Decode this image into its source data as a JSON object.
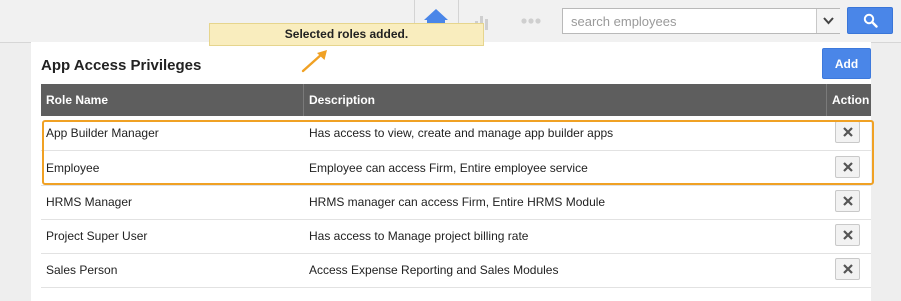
{
  "topbar": {
    "icons": [
      "home-icon",
      "bar-chart-icon",
      "more-dots-icon",
      "chevron-down-icon",
      "search-icon"
    ],
    "search_placeholder": "search employees"
  },
  "toast": {
    "message": "Selected roles added."
  },
  "section": {
    "title": "App Access Privileges",
    "add_label": "Add"
  },
  "table": {
    "headers": [
      "Role Name",
      "Description",
      "Action"
    ],
    "rows": [
      {
        "role": "App Builder Manager",
        "description": "Has access to view, create and manage app builder apps"
      },
      {
        "role": "Employee",
        "description": "Employee can access Firm, Entire employee service"
      },
      {
        "role": "HRMS Manager",
        "description": "HRMS manager can access Firm, Entire HRMS Module"
      },
      {
        "role": "Project Super User",
        "description": "Has access to Manage project billing rate"
      },
      {
        "role": "Sales Person",
        "description": "Access Expense Reporting and Sales Modules"
      }
    ]
  },
  "colors": {
    "accent": "#4a86e8",
    "highlight": "#f0a124",
    "header_bg": "#5e5e5e",
    "toast_bg": "#f9edbe"
  }
}
